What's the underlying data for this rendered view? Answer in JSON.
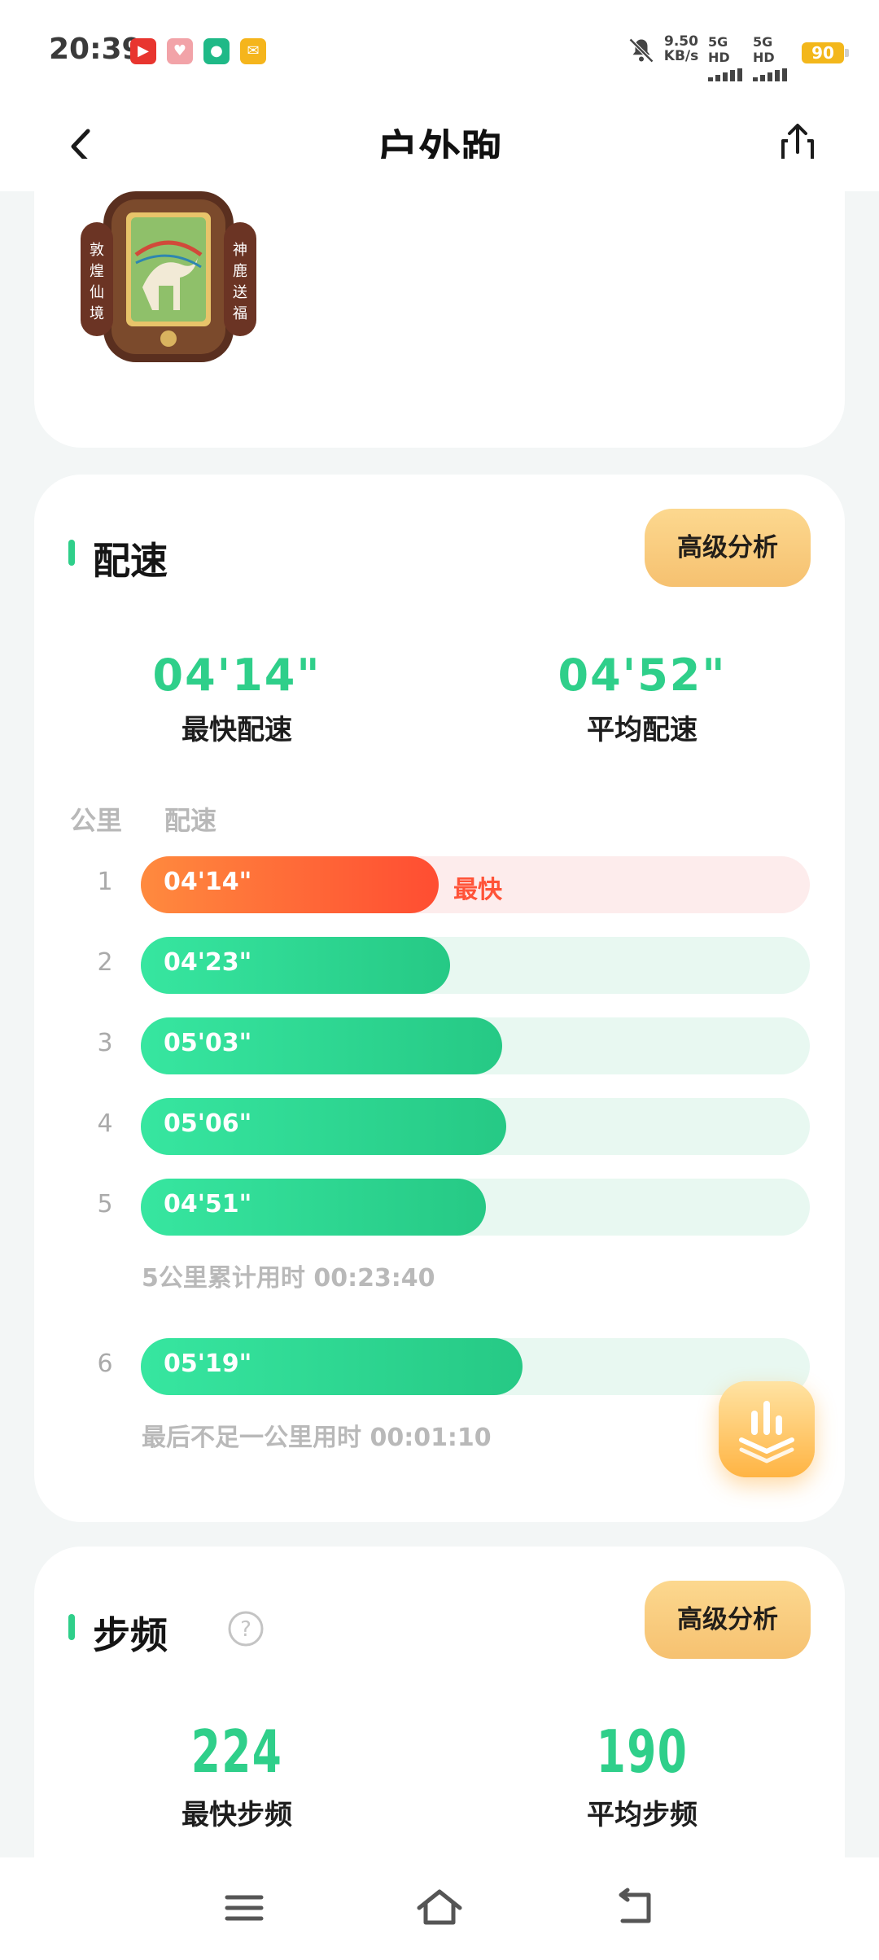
{
  "status_bar": {
    "time": "20:39",
    "net_speed_value": "9.50",
    "net_speed_unit": "KB/s",
    "signal_1": "5G HD",
    "signal_2": "5G HD",
    "battery": "90",
    "app_icons": [
      "video-app-icon",
      "heart-app-icon",
      "green-app-icon",
      "mail-app-icon"
    ]
  },
  "header": {
    "title": "户外跑",
    "back_icon": "chevron-left-icon",
    "share_icon": "share-icon"
  },
  "medal": {
    "left_text": "敦煌仙境",
    "right_text": "神鹿送福"
  },
  "pace": {
    "title": "配速",
    "advanced_button": "高级分析",
    "fastest_value": "04'14\"",
    "fastest_label": "最快配速",
    "average_value": "04'52\"",
    "average_label": "平均配速",
    "col_km": "公里",
    "col_pace": "配速",
    "fastest_tag": "最快",
    "rows": [
      {
        "km": "1",
        "pace": "04'14\"",
        "fill_fraction": 0.445,
        "fastest": true
      },
      {
        "km": "2",
        "pace": "04'23\"",
        "fill_fraction": 0.462,
        "fastest": false
      },
      {
        "km": "3",
        "pace": "05'03\"",
        "fill_fraction": 0.54,
        "fastest": false
      },
      {
        "km": "4",
        "pace": "05'06\"",
        "fill_fraction": 0.546,
        "fastest": false
      },
      {
        "km": "5",
        "pace": "04'51\"",
        "fill_fraction": 0.516,
        "fastest": false
      },
      {
        "km": "6",
        "pace": "05'19\"",
        "fill_fraction": 0.57,
        "fastest": false
      }
    ],
    "cumulative_note": "5公里累计用时 00:23:40",
    "last_note": "最后不足一公里用时 00:01:10"
  },
  "cadence": {
    "title": "步频",
    "advanced_button": "高级分析",
    "fastest_value": "224",
    "fastest_label": "最快步频",
    "average_value": "190",
    "average_label": "平均步频"
  },
  "colors": {
    "accent_green": "#2fcf8a",
    "fastest_red": "#ff4d32",
    "button_gold": "#f6c170"
  }
}
